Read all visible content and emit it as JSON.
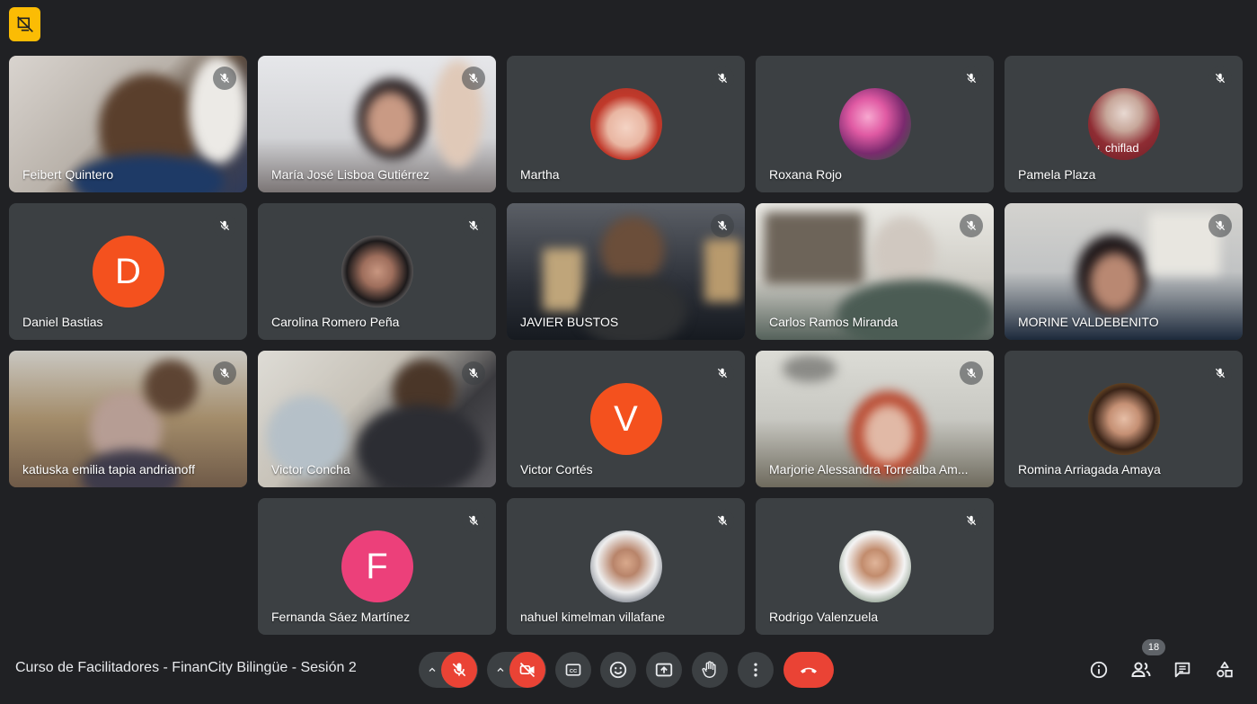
{
  "meeting": {
    "title": "Curso de Facilitadores - FinanCity Bilingüe - Sesión 2",
    "participant_count": "18"
  },
  "participants": [
    {
      "name": "Feibert Quintero",
      "type": "video",
      "muted": true
    },
    {
      "name": "María José Lisboa Gutiérrez",
      "type": "video",
      "muted": true
    },
    {
      "name": "Martha",
      "type": "avatar-image",
      "muted": true
    },
    {
      "name": "Roxana Rojo",
      "type": "avatar-image",
      "muted": true
    },
    {
      "name": "Pamela Plaza",
      "type": "avatar-image",
      "muted": true
    },
    {
      "name": "Daniel Bastias",
      "type": "avatar-letter",
      "letter": "D",
      "color": "#f4511e",
      "muted": true
    },
    {
      "name": "Carolina Romero Peña",
      "type": "avatar-image",
      "muted": true
    },
    {
      "name": "JAVIER BUSTOS",
      "type": "video",
      "muted": true
    },
    {
      "name": "Carlos Ramos Miranda",
      "type": "video",
      "muted": true
    },
    {
      "name": "MORINE VALDEBENITO",
      "type": "video",
      "muted": true
    },
    {
      "name": "katiuska emilia tapia andrianoff",
      "type": "video",
      "muted": true
    },
    {
      "name": "Victor Concha",
      "type": "video",
      "muted": true
    },
    {
      "name": "Victor Cortés",
      "type": "avatar-letter",
      "letter": "V",
      "color": "#f4511e",
      "muted": true
    },
    {
      "name": "Marjorie Alessandra Torrealba Am...",
      "type": "video",
      "muted": true
    },
    {
      "name": "Romina Arriagada Amaya",
      "type": "avatar-image",
      "muted": true
    },
    {
      "name": "Fernanda Sáez Martínez",
      "type": "avatar-letter",
      "letter": "F",
      "color": "#ec407a",
      "muted": true
    },
    {
      "name": "nahuel kimelman villafane",
      "type": "avatar-image",
      "muted": true
    },
    {
      "name": "Rodrigo Valenzuela",
      "type": "avatar-image",
      "muted": true
    }
  ],
  "pamela_avatar_text": "¿ chiflad",
  "controls": {
    "mic": {
      "icon": "mic-off-icon",
      "state": "off"
    },
    "camera": {
      "icon": "videocam-off-icon",
      "state": "off"
    },
    "captions": {
      "icon": "closed-captions-icon"
    },
    "reactions": {
      "icon": "emoji-icon"
    },
    "present": {
      "icon": "present-screen-icon"
    },
    "raise_hand": {
      "icon": "hand-icon"
    },
    "more": {
      "icon": "more-vert-icon"
    },
    "leave": {
      "icon": "end-call-icon"
    }
  },
  "right_controls": [
    "info-icon",
    "people-icon",
    "chat-icon",
    "activities-icon"
  ],
  "colors": {
    "background": "#202124",
    "tile": "#3c4043",
    "danger": "#ea4335",
    "recording_badge": "#fbbc04"
  }
}
